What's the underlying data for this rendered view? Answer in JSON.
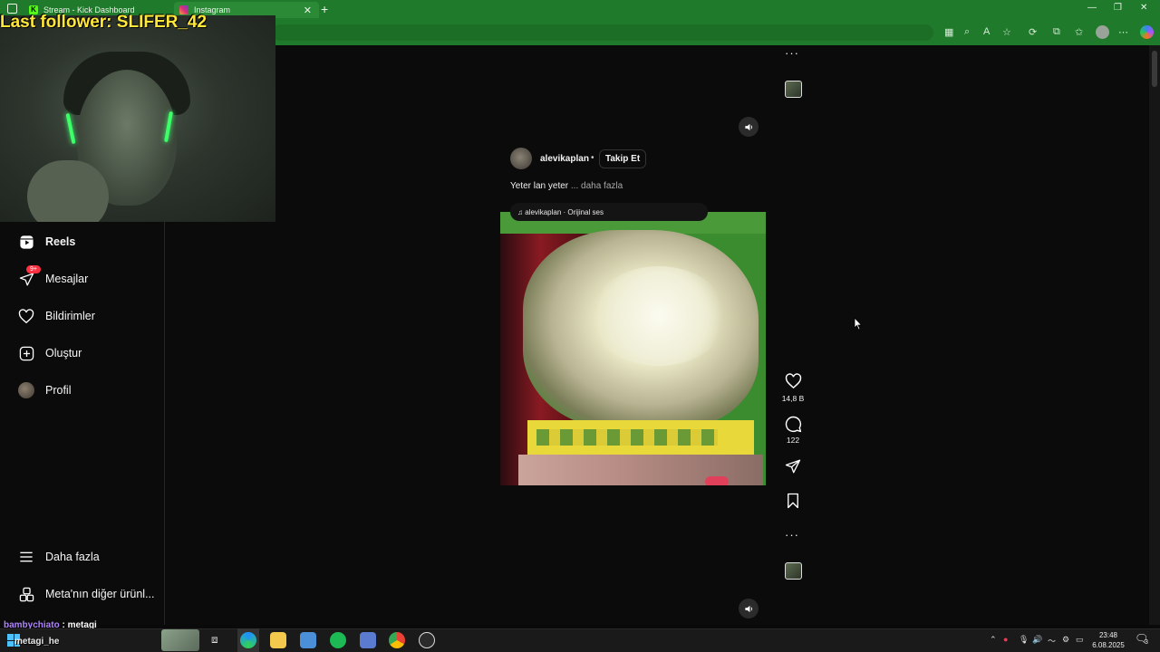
{
  "browser": {
    "tabs": [
      {
        "label": "Stream - Kick Dashboard",
        "icon": "kick-icon",
        "favicon_text": "K"
      },
      {
        "label": "Instagram",
        "icon": "instagram-icon"
      }
    ],
    "accent_color": "#1f7a2b"
  },
  "overlay": {
    "last_follower": "Last follower: SLIFER_42",
    "chat_user": "bambychiato",
    "chat_separator": ":",
    "chat_message": "metagi",
    "streamer_name": "metagi_he"
  },
  "sidebar": {
    "items": [
      {
        "label": "Reels",
        "icon": "reels-icon",
        "active": true
      },
      {
        "label": "Mesajlar",
        "icon": "messages-icon",
        "badge": "9+"
      },
      {
        "label": "Bildirimler",
        "icon": "heart-icon"
      },
      {
        "label": "Oluştur",
        "icon": "create-icon"
      },
      {
        "label": "Profil",
        "icon": "profile-avatar"
      },
      {
        "label": "Daha fazla",
        "icon": "menu-icon"
      },
      {
        "label": "Meta'nın diğer ürünl...",
        "icon": "meta-apps-icon"
      }
    ]
  },
  "post": {
    "username": "alevikaplan",
    "dot": "•",
    "follow_label": "Takip Et",
    "caption": "Yeter lan yeter",
    "caption_more": "... daha fazla",
    "audio": "alevikaplan · Orijinal ses",
    "likes": "14,8 B",
    "comments": "122"
  },
  "taskbar": {
    "time": "23:48",
    "date": "6.08.2025",
    "notifications": "3"
  }
}
